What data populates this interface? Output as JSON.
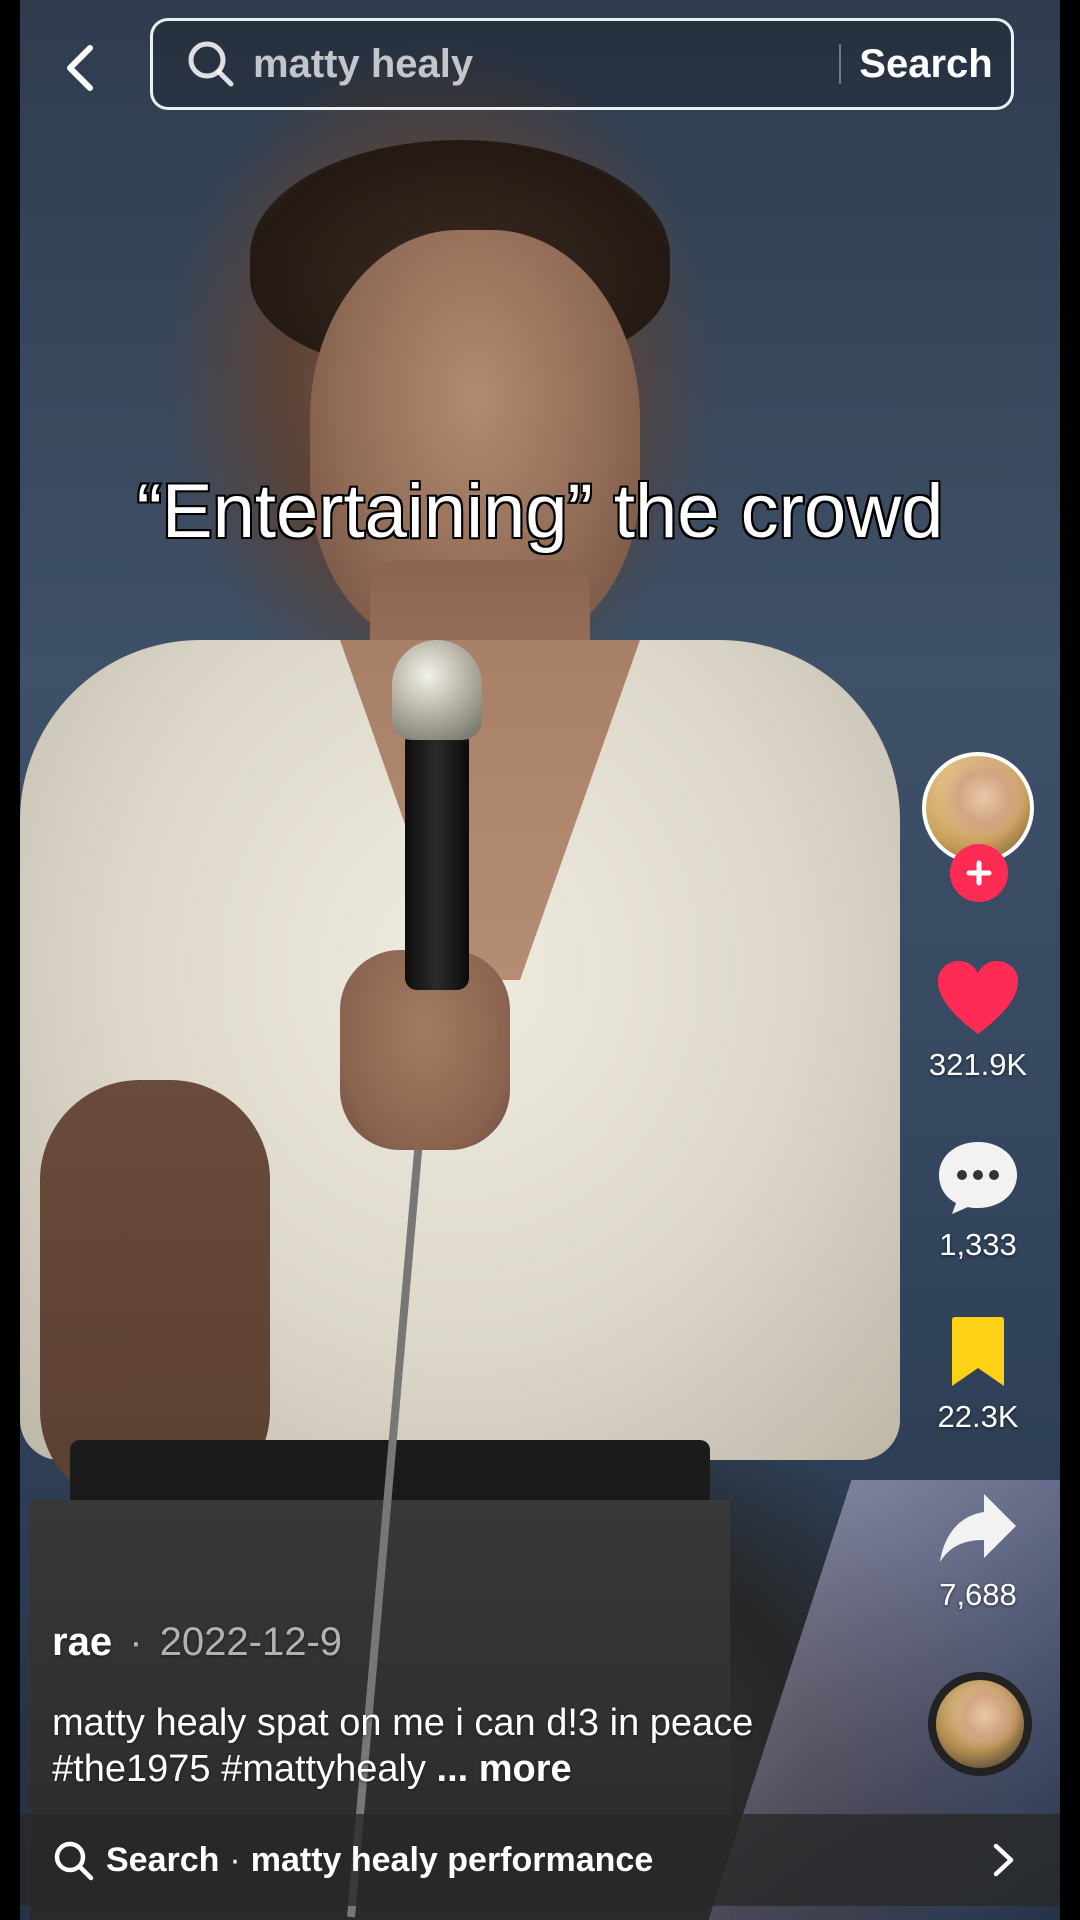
{
  "search": {
    "query": "matty healy",
    "submit_label": "Search"
  },
  "video": {
    "overlay_caption": "“Entertaining” the crowd"
  },
  "actions": {
    "likes": "321.9K",
    "comments": "1,333",
    "saves": "22.3K",
    "shares": "7,688"
  },
  "post": {
    "username": "rae",
    "separator": "·",
    "date": "2022-12-9",
    "caption": "matty healy spat on me i can d!3 in peace",
    "hashtags": [
      "#the1975",
      "#mattyhealy"
    ],
    "more_label": "... more"
  },
  "related_search": {
    "label": "Search",
    "separator": "·",
    "term": "matty healy performance"
  },
  "colors": {
    "like_red": "#fe2c55",
    "bookmark_yellow": "#fcd116",
    "follow_pink": "#fe2c55"
  },
  "icons": {
    "back": "chevron-left-icon",
    "search": "search-icon",
    "like": "heart-icon",
    "comment": "comment-bubble-icon",
    "save": "bookmark-icon",
    "share": "share-arrow-icon",
    "follow": "plus-icon",
    "related_chevron": "chevron-right-icon"
  }
}
